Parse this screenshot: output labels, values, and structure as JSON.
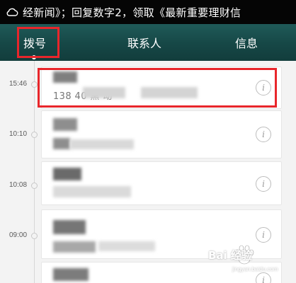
{
  "ticker": {
    "icon": "cloud-icon",
    "text": "经新闻》；回复数字2，领取《最新重要理财信"
  },
  "tabs": [
    {
      "label": "拨号",
      "selected": true
    },
    {
      "label": "联系人",
      "selected": false
    },
    {
      "label": "信息",
      "selected": false
    }
  ],
  "call_log": {
    "times": [
      "15:46",
      "10:10",
      "10:08",
      "09:00"
    ],
    "entries": [
      {
        "name": "",
        "detail": "138        40 黑                 动",
        "info_label": "i"
      },
      {
        "name": "",
        "detail": "",
        "info_label": "i"
      },
      {
        "name": "",
        "detail": "",
        "info_label": "i"
      },
      {
        "name": "",
        "detail": "",
        "info_label": "i"
      },
      {
        "name": "",
        "detail": "",
        "info_label": "i"
      }
    ]
  },
  "watermark": {
    "text": "Bai 经验",
    "sub": "jingyan.baidu.com"
  },
  "colors": {
    "tabbar": "#164746",
    "highlight": "#e8262b",
    "ticker_bg": "#050505",
    "list_bg": "#f3f3f3"
  }
}
